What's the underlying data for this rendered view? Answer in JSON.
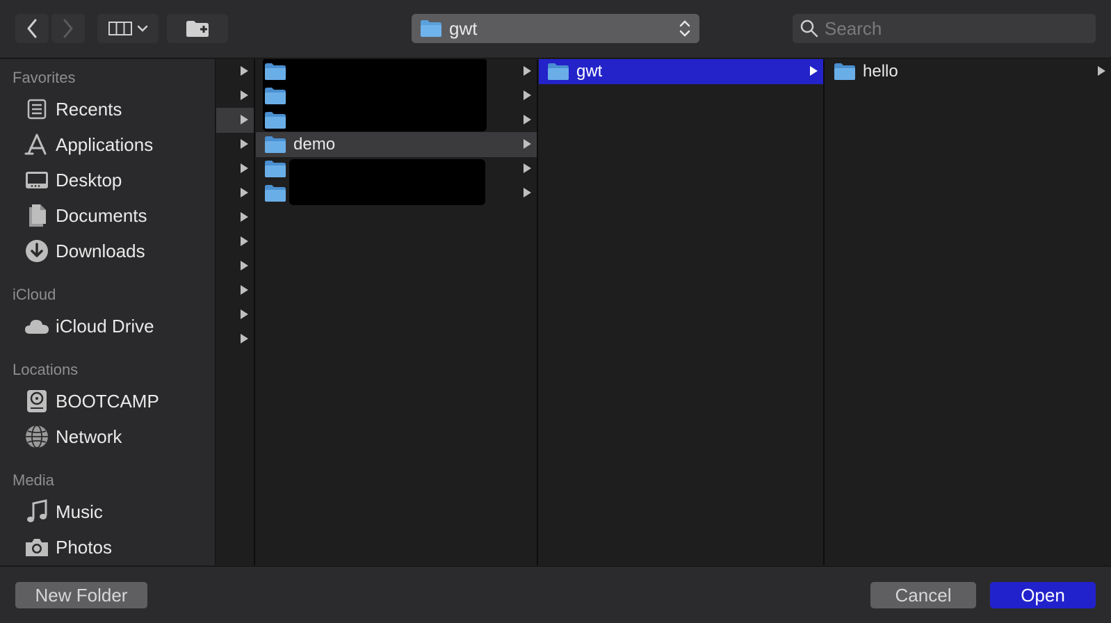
{
  "toolbar": {
    "path_label": "gwt",
    "search_placeholder": "Search"
  },
  "sidebar": {
    "sections": [
      {
        "title": "Favorites"
      },
      {
        "title": "iCloud"
      },
      {
        "title": "Locations"
      },
      {
        "title": "Media"
      }
    ],
    "items": [
      {
        "label": "Recents",
        "icon": "recents-icon"
      },
      {
        "label": "Applications",
        "icon": "applications-icon"
      },
      {
        "label": "Desktop",
        "icon": "desktop-icon"
      },
      {
        "label": "Documents",
        "icon": "documents-icon"
      },
      {
        "label": "Downloads",
        "icon": "downloads-icon"
      },
      {
        "label": "iCloud Drive",
        "icon": "cloud-icon"
      },
      {
        "label": "BOOTCAMP",
        "icon": "disk-icon"
      },
      {
        "label": "Network",
        "icon": "network-icon"
      },
      {
        "label": "Music",
        "icon": "music-note-icon"
      },
      {
        "label": "Photos",
        "icon": "camera-icon"
      }
    ]
  },
  "columns": {
    "col2": {
      "selected_label": "demo"
    },
    "col3": {
      "selected_label": "gwt"
    },
    "col4": {
      "items": [
        {
          "label": "hello"
        }
      ]
    }
  },
  "buttons": {
    "new_folder": "New Folder",
    "cancel": "Cancel",
    "open": "Open"
  },
  "colors": {
    "accent_blue": "#2323c9",
    "folder_blue": "#5aa0dc"
  }
}
